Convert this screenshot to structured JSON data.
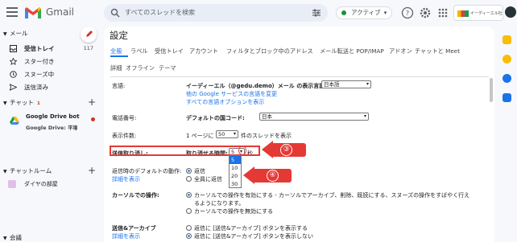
{
  "header": {
    "brand": "Gmail",
    "search_placeholder": "すべてのスレッドを検索",
    "status": "アクティブ",
    "account_text": "イーディーエル社"
  },
  "sidebar": {
    "mail_heading": "メール",
    "items": [
      {
        "label": "受信トレイ",
        "count": "117",
        "bold": true,
        "icon": "inbox-icon"
      },
      {
        "label": "スター付き",
        "count": "",
        "icon": "star-icon"
      },
      {
        "label": "スヌーズ中",
        "count": "",
        "icon": "clock-icon"
      },
      {
        "label": "送信済み",
        "count": "",
        "icon": "send-icon"
      }
    ],
    "chat_heading": "チャット",
    "chat_badge": "1",
    "bot_name": "Google Drive bot",
    "bot_preview": "Google Drive: 平塚知...",
    "rooms_heading": "チャットルーム",
    "room_name": "ダイヤの部屋",
    "footer": "会議"
  },
  "settings": {
    "title": "設定",
    "tabs": [
      "全般",
      "ラベル",
      "受信トレイ",
      "アカウント",
      "フィルタとブロック中のアドレス",
      "メール転送と POP/IMAP",
      "アドオン",
      "チャットと Meet"
    ],
    "tabs2": [
      "詳細",
      "オフライン",
      "テーマ"
    ],
    "language": {
      "label": "言語:",
      "text": "イーディーエル（@gedu.demo）メール の表示言語:",
      "value": "日本語",
      "link1": "他の Google サービスの言語を変更",
      "link2": "すべての言語オプションを表示"
    },
    "phone": {
      "label": "電話番号:",
      "text": "デフォルトの国コード:",
      "value": "日本"
    },
    "page_size": {
      "label": "表示件数:",
      "prefix": "1 ページに",
      "value": "50",
      "suffix": "件のスレッドを表示"
    },
    "undo": {
      "label": "送信取り消し:",
      "text": "取り消せる時間:",
      "value": "5",
      "unit": "秒",
      "options": [
        "5",
        "10",
        "20",
        "30"
      ]
    },
    "reply": {
      "label": "返信時のデフォルトの動作:",
      "link": "詳細を表示",
      "opt1": "返信",
      "opt2": "全員に返信"
    },
    "hover": {
      "label": "カーソルでの操作:",
      "opt1": "カーソルでの操作を有効にする - カーソルでアーカイブ、削除、既読にする、スヌーズの操作をすばやく行え",
      "opt1b": "るようになります。",
      "opt2": "カーソルでの操作を無効にする"
    },
    "archive": {
      "label": "送信&アーカイブ",
      "link": "詳細を表示",
      "opt1": "返信に [送信&アーカイブ] ボタンを表示する",
      "opt2": "返信に [送信&アーカイブ] ボタンを表示しない"
    }
  },
  "callouts": {
    "three": "③",
    "four": "④"
  },
  "colors": {
    "accent": "#1a73e8",
    "annotation": "#e53935"
  }
}
